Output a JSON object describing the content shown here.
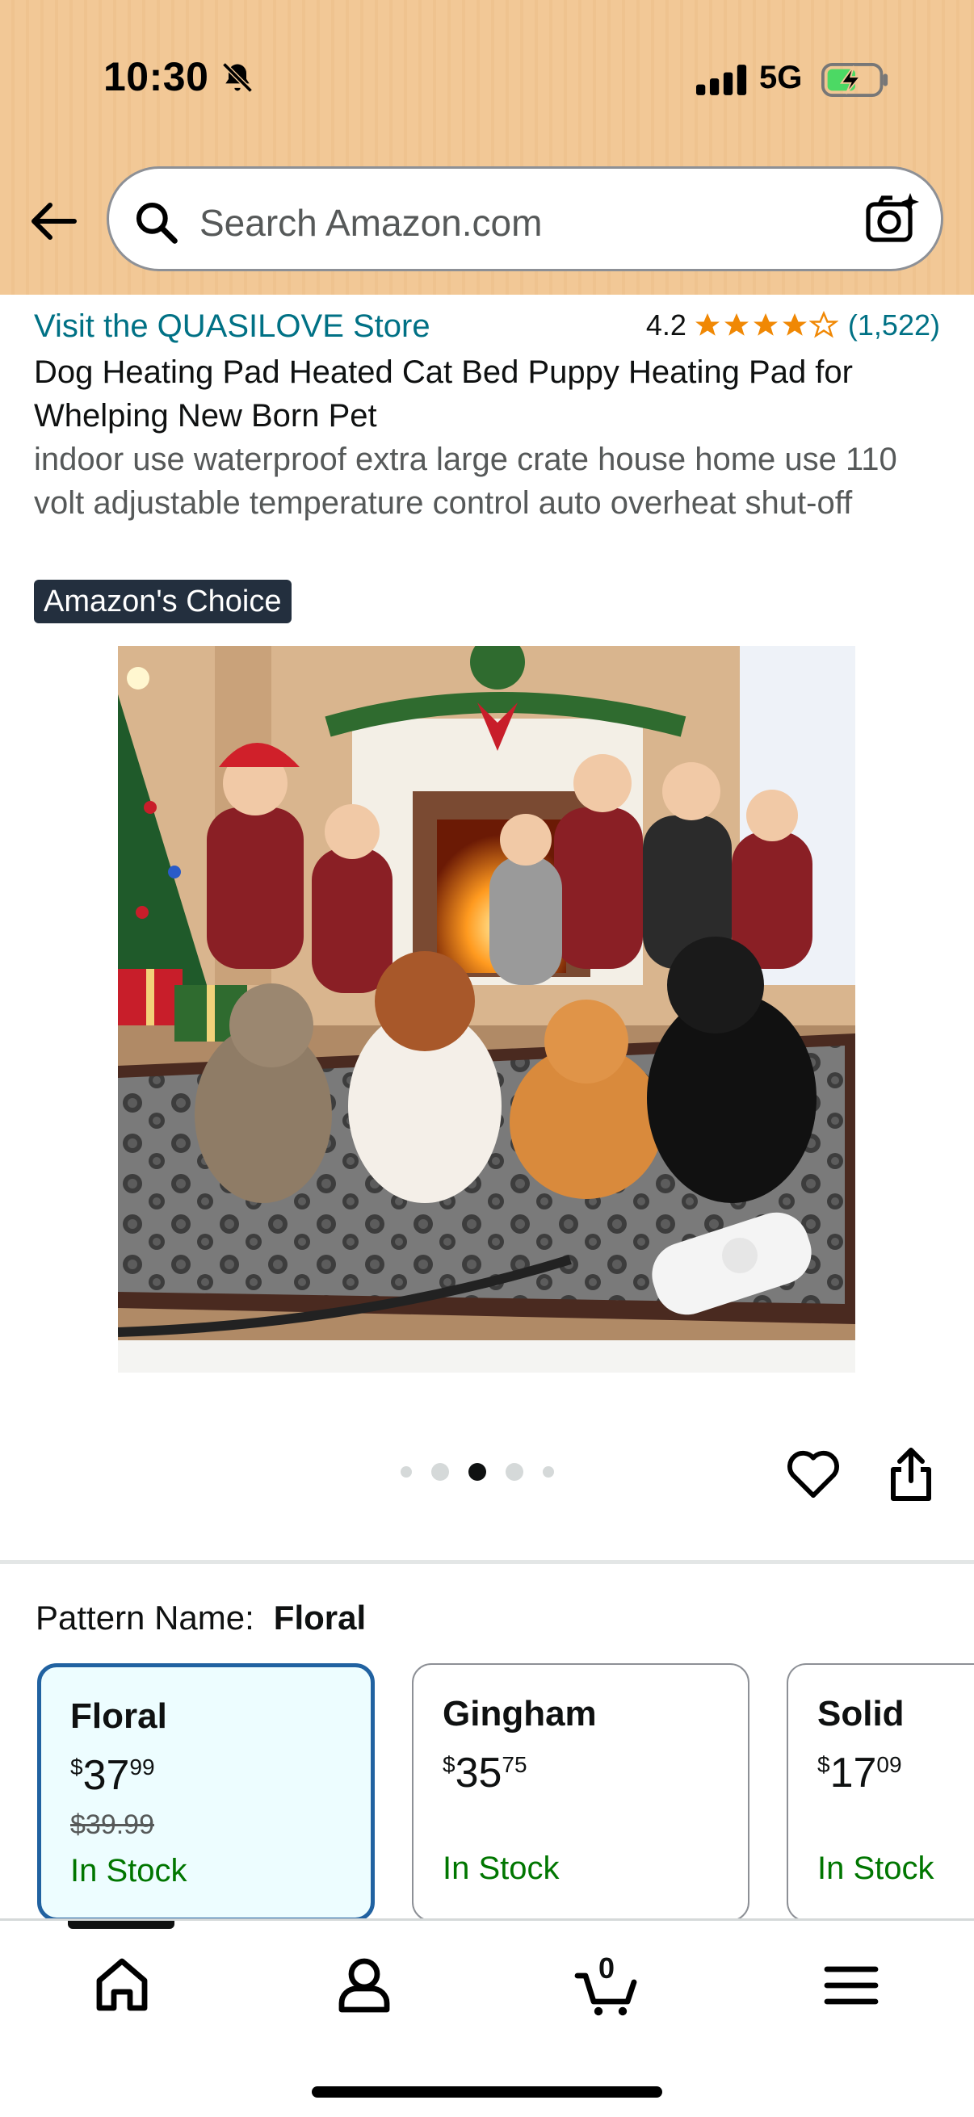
{
  "status_bar": {
    "time": "10:30",
    "network": "5G"
  },
  "search": {
    "placeholder": "Search Amazon.com"
  },
  "product": {
    "store_link": "Visit the QUASILOVE Store",
    "rating": "4.2",
    "rating_stars": 4.2,
    "review_count": "(1,522)",
    "title": "Dog Heating Pad Heated Cat Bed Puppy Heating Pad for Whelping New Born Pet",
    "subtitle": "indoor use waterproof extra large crate house home use 110 volt adjustable temperature control auto overheat shut-off",
    "badge": "Amazon's Choice",
    "image_position": "3 of 5"
  },
  "pattern": {
    "label": "Pattern Name:",
    "selected": "Floral"
  },
  "variants": [
    {
      "name": "Floral",
      "currency": "$",
      "dollars": "37",
      "cents": "99",
      "list_price": "$39.99",
      "stock": "In Stock"
    },
    {
      "name": "Gingham",
      "currency": "$",
      "dollars": "35",
      "cents": "75",
      "stock": "In Stock"
    },
    {
      "name": "Solid",
      "currency": "$",
      "dollars": "17",
      "cents": "09",
      "stock": "In Stock"
    }
  ],
  "nav": {
    "cart_count": "0"
  },
  "colors": {
    "header_bg": "#f2c896",
    "link": "#007185",
    "star": "#f08804",
    "badge_bg": "#232f3e",
    "selected_border": "#2162a1",
    "in_stock": "#007600"
  },
  "icons": [
    "bell-muted-icon",
    "signal-icon",
    "battery-charging-icon",
    "back-arrow-icon",
    "search-icon",
    "camera-search-icon",
    "heart-icon",
    "share-icon",
    "home-icon",
    "account-icon",
    "cart-icon",
    "menu-icon"
  ]
}
